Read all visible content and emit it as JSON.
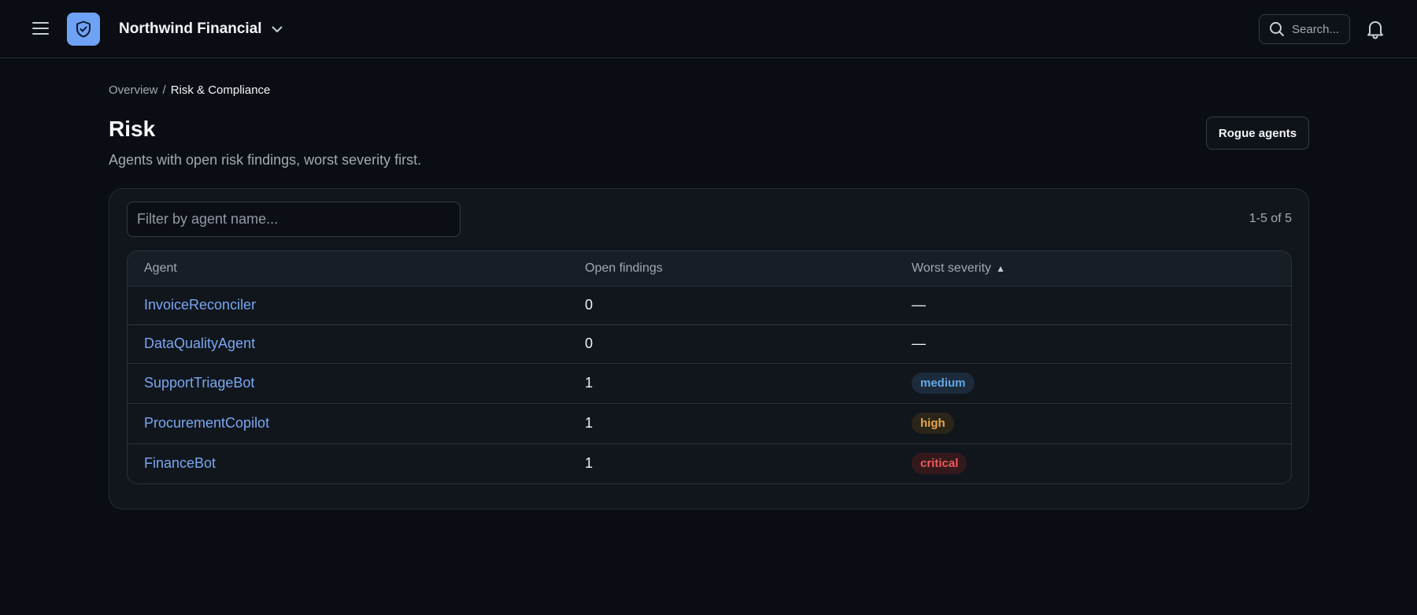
{
  "header": {
    "org_name": "Northwind Financial",
    "search_placeholder": "Search...",
    "icons": [
      "hamburger-icon",
      "shield-check-icon",
      "chevron-down-icon",
      "search-icon",
      "bell-icon"
    ],
    "brand_color": "#6ea2f5"
  },
  "breadcrumb": {
    "parent": "Overview",
    "separator": "/",
    "current": "Risk & Compliance"
  },
  "page": {
    "title": "Risk",
    "subtitle": "Agents with open risk findings, worst severity first.",
    "action_button": "Rogue agents"
  },
  "filter": {
    "placeholder": "Filter by agent name...",
    "value": ""
  },
  "pagination": {
    "range_text": "1-5 of 5"
  },
  "table": {
    "columns": {
      "agent": "Agent",
      "findings": "Open findings",
      "severity": "Worst severity",
      "sort_indicator": "▲"
    },
    "rows": [
      {
        "agent": "InvoiceReconciler",
        "findings": "0",
        "severity": "—"
      },
      {
        "agent": "DataQualityAgent",
        "findings": "0",
        "severity": "—"
      },
      {
        "agent": "SupportTriageBot",
        "findings": "1",
        "severity": "medium"
      },
      {
        "agent": "ProcurementCopilot",
        "findings": "1",
        "severity": "high"
      },
      {
        "agent": "FinanceBot",
        "findings": "1",
        "severity": "critical"
      }
    ]
  },
  "severity_colors": {
    "medium": "#63a7e6",
    "high": "#e7a64a",
    "critical": "#ef5a5a"
  }
}
